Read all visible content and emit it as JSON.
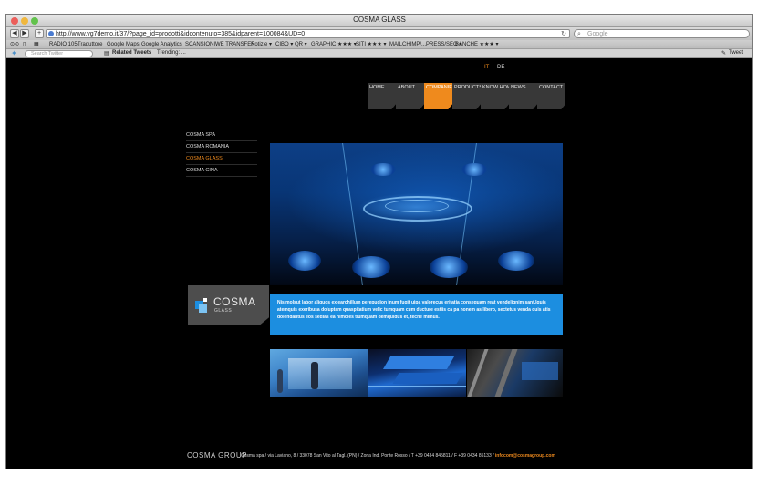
{
  "window": {
    "title": "COSMA GLASS"
  },
  "toolbar": {
    "url": "http://www.vg7demo.it/37/?page_id=prodotti&idcontenuto=385&idparent=100084&UD=0",
    "google_placeholder": "Google"
  },
  "bookmarks": [
    "RADIO 105",
    "Traduttore",
    "Google Maps",
    "Google Analytics",
    "SCANSIONI",
    "WE TRANSFER",
    "Notizie ▾",
    "CIBO ▾",
    "QR ▾",
    "GRAPHIC ★★★ ▾",
    "SITI ★★★ ▾",
    "MAILCHIMP/...PRESS/SEO ▾",
    "BANCHE ★★★ ▾"
  ],
  "twitter_bar": {
    "search_placeholder": "Search Twitter",
    "related": "Related Tweets",
    "trending": "Trending: ...",
    "tweet": "Tweet"
  },
  "lang": {
    "it": "IT",
    "de": "DE"
  },
  "nav": {
    "tabs": [
      "HOME",
      "ABOUT",
      "COMPANIES",
      "PRODUCTS",
      "KNOW HOW",
      "NEWS",
      "CONTACT"
    ],
    "active_index": 2
  },
  "sidebar": {
    "items": [
      "COSMA SPA",
      "COSMA ROMANIA",
      "COSMA GLASS",
      "COSMA CINA"
    ],
    "active_index": 2
  },
  "logo": {
    "word": "COSMA",
    "sub": "GLASS"
  },
  "description": "Nis molsut labor aliquos ex earchillum perepudion inum fugit uipa valorecus eritatia consequam reat vendelignim sant.Iquis atemquis exeribusa doluptam quaspitatium velic tumquam cum ducture estiis ca pa nonem as libero, sectetus venda quis atis dolendantus eos sedias ea nimoles tiumquam demquidus et, tecne mimus.",
  "footer": {
    "logo": "COSMA GROUP",
    "address": "Cosma spa / via Laviano, 8 / 33078 San Vito al Tagl. (PN) / Zona Ind. Ponte Rosso / T +39 0434 845811 / F +39 0434 85133 /",
    "email": "infocom@cosmagroup.com"
  },
  "colors": {
    "accent": "#ef8a1d",
    "blue": "#1c8ee0",
    "background": "#000000",
    "tab": "#383838"
  }
}
